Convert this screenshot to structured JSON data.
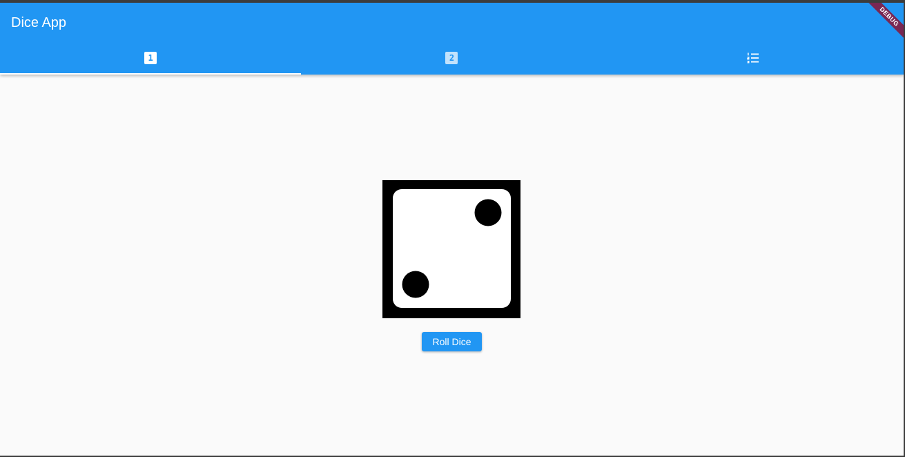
{
  "app": {
    "title": "Dice App",
    "debug_label": "DEBUG"
  },
  "tabs": [
    {
      "icon": "looks-one-icon",
      "glyph": "1",
      "active": true
    },
    {
      "icon": "looks-two-icon",
      "glyph": "2",
      "active": false
    },
    {
      "icon": "format-list-numbered-icon",
      "active": false
    }
  ],
  "dice": {
    "face_value": 2,
    "icon": "dice-two-icon"
  },
  "roll_button": {
    "label": "Roll Dice"
  },
  "colors": {
    "primary": "#2196f3",
    "background": "#fafafa",
    "debug_banner": "#881436"
  }
}
